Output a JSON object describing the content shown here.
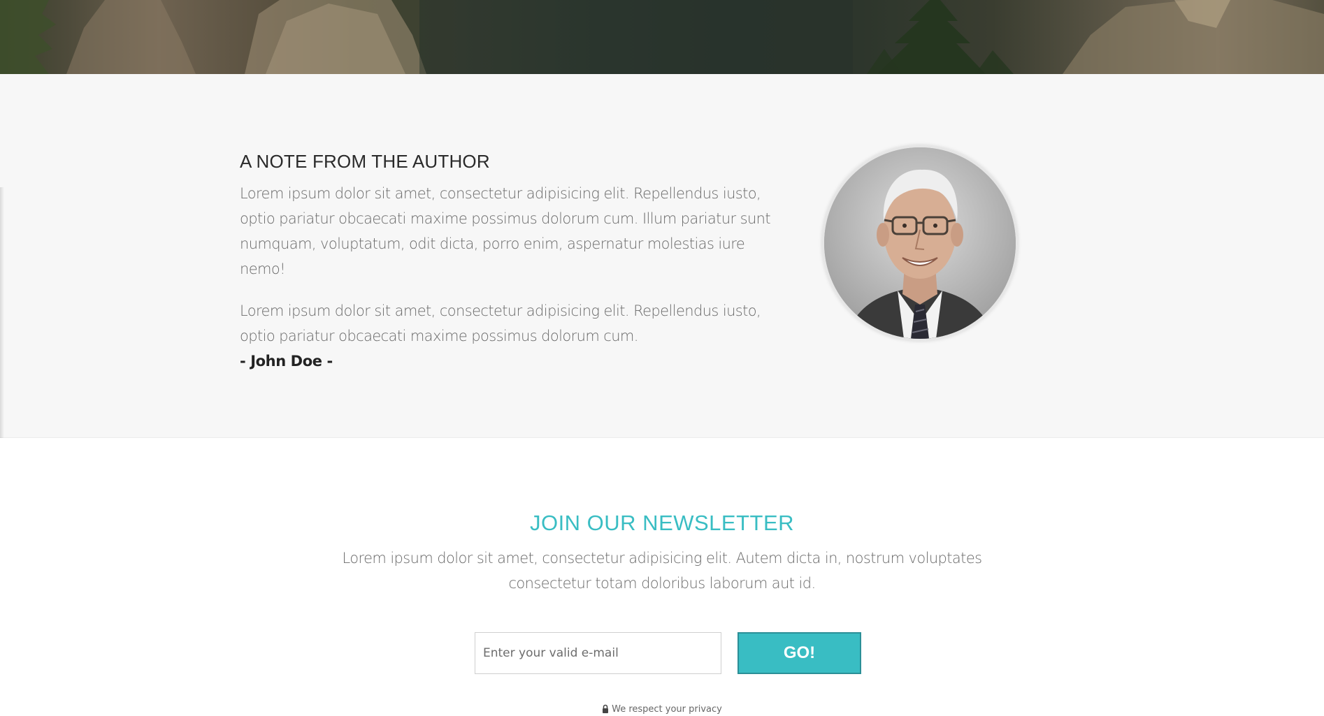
{
  "hero": {
    "image": "mountain-forest-photo"
  },
  "author": {
    "title": "A NOTE FROM THE AUTHOR",
    "paragraphs": [
      "Lorem ipsum dolor sit amet, consectetur adipisicing elit. Repellendus iusto, optio pariatur obcaecati maxime possimus dolorum cum. Illum pariatur sunt numquam, voluptatum, odit dicta, porro enim, aspernatur molestias iure nemo!",
      "Lorem ipsum dolor sit amet, consectetur adipisicing elit. Repellendus iusto, optio pariatur obcaecati maxime possimus dolorum cum."
    ],
    "signature": "- John Doe -",
    "photo": "author-portrait"
  },
  "newsletter": {
    "title": "JOIN OUR NEWSLETTER",
    "text": "Lorem ipsum dolor sit amet, consectetur adipisicing elit. Autem dicta in, nostrum voluptates consectetur totam doloribus laborum aut id.",
    "email_placeholder": "Enter your valid e-mail",
    "email_value": "",
    "button_label": "GO!",
    "privacy_text": "We respect your privacy",
    "privacy_icon": "lock-icon"
  },
  "colors": {
    "accent": "#39bdc3",
    "section_bg": "#f7f7f7"
  }
}
